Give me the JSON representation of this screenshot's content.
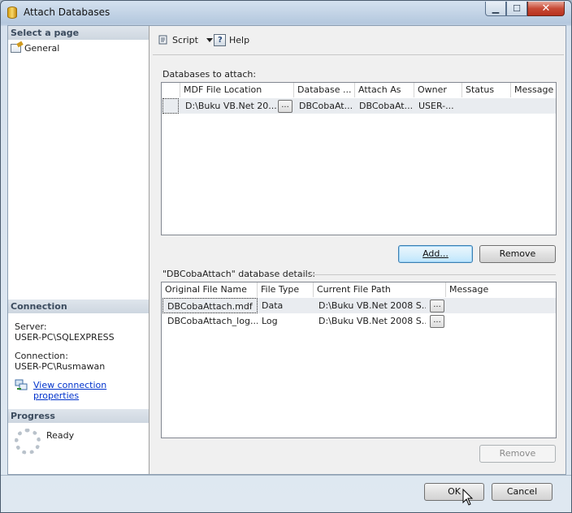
{
  "window": {
    "title": "Attach Databases"
  },
  "left_pane": {
    "select_page_heading": "Select a page",
    "pages": [
      "General"
    ],
    "connection_heading": "Connection",
    "server_label": "Server:",
    "server_value": "USER-PC\\SQLEXPRESS",
    "connection_label": "Connection:",
    "connection_value": "USER-PC\\Rusmawan",
    "view_connection_link": "View connection properties",
    "progress_heading": "Progress",
    "progress_status": "Ready"
  },
  "toolbar": {
    "script_label": "Script",
    "help_label": "Help"
  },
  "attach": {
    "label": "Databases to attach:",
    "columns": [
      "MDF File Location",
      "Database ...",
      "Attach As",
      "Owner",
      "Status",
      "Message"
    ],
    "rows": [
      {
        "mdf": "D:\\Buku VB.Net 20...",
        "database": "DBCobaAt...",
        "attach_as": "DBCobaAt...",
        "owner": "USER-...",
        "status": "",
        "message": ""
      }
    ],
    "add_label": "Add...",
    "remove_label": "Remove"
  },
  "details": {
    "label": "\"DBCobaAttach\" database details:",
    "columns": [
      "Original File Name",
      "File Type",
      "Current File Path",
      "Message"
    ],
    "rows": [
      {
        "name": "DBCobaAttach.mdf",
        "type": "Data",
        "path": "D:\\Buku VB.Net 2008 S...",
        "message": ""
      },
      {
        "name": "DBCobaAttach_log....",
        "type": "Log",
        "path": "D:\\Buku VB.Net 2008 S...",
        "message": ""
      }
    ],
    "remove_label": "Remove"
  },
  "footer": {
    "ok_label": "OK",
    "cancel_label": "Cancel"
  },
  "ellipsis": "..."
}
